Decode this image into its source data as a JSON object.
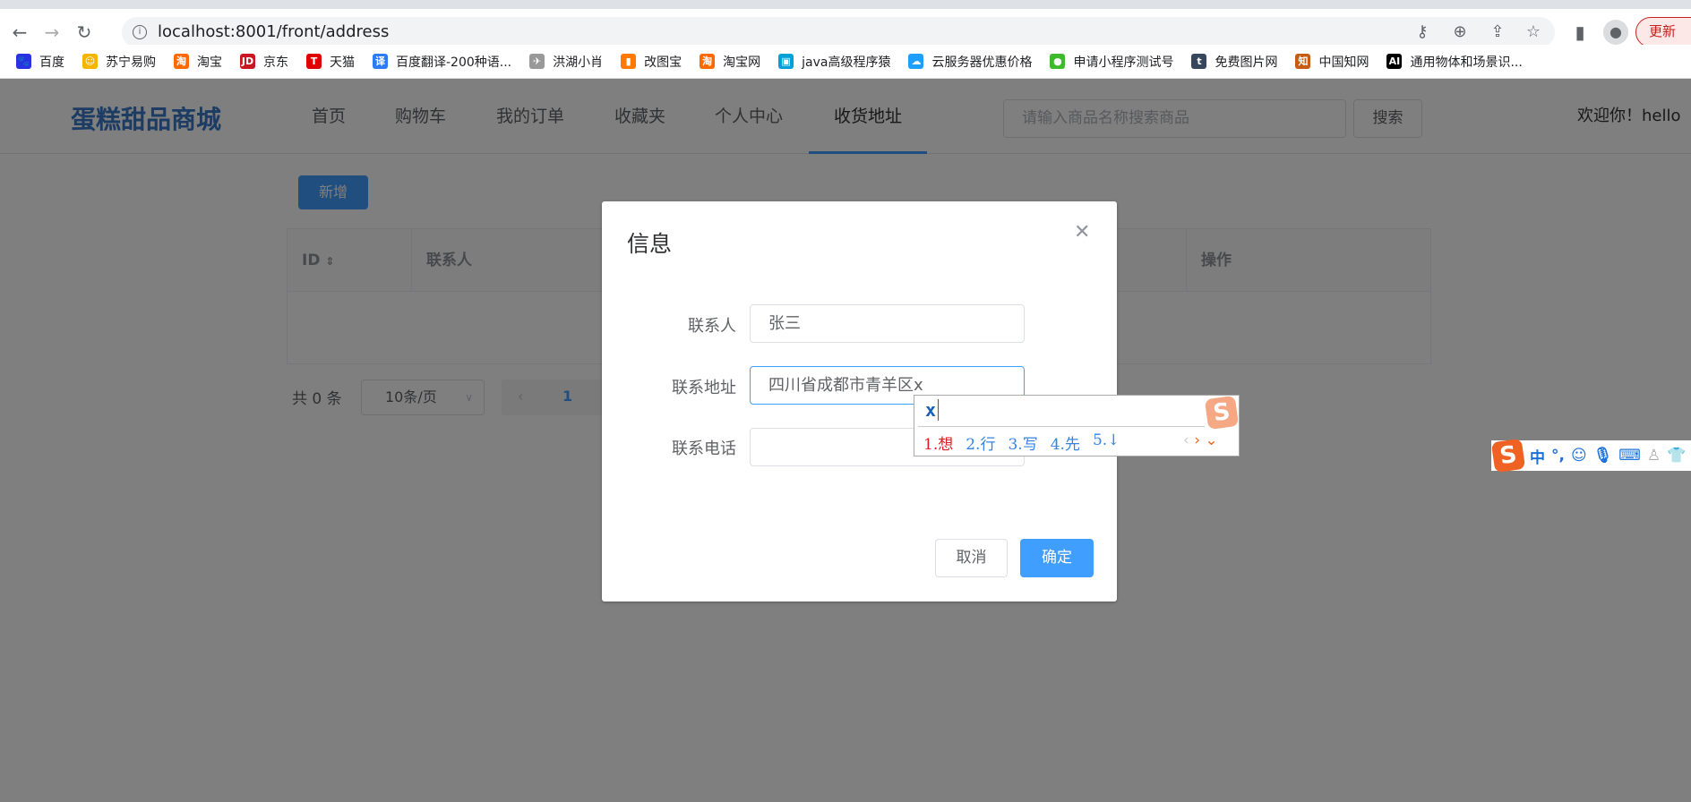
{
  "browser": {
    "url": "localhost:8001/front/address",
    "update_label": "更新",
    "bookmarks": [
      {
        "label": "百度",
        "icon": "baidu-icon",
        "color": "#2932e1",
        "glyph": "🐾"
      },
      {
        "label": "苏宁易购",
        "icon": "suning-icon",
        "color": "#f5b400",
        "glyph": "☺"
      },
      {
        "label": "淘宝",
        "icon": "taobao-icon",
        "color": "#ff6a00",
        "glyph": "淘"
      },
      {
        "label": "京东",
        "icon": "jd-icon",
        "color": "#c81623",
        "glyph": "JD"
      },
      {
        "label": "天猫",
        "icon": "tmall-icon",
        "color": "#e00000",
        "glyph": "T"
      },
      {
        "label": "百度翻译-200种语...",
        "icon": "translate-icon",
        "color": "#2b7cf6",
        "glyph": "译"
      },
      {
        "label": "洪湖小肖",
        "icon": "bird-icon",
        "color": "#999999",
        "glyph": "✈"
      },
      {
        "label": "改图宝",
        "icon": "gaitubao-icon",
        "color": "#ff7a00",
        "glyph": "▮"
      },
      {
        "label": "淘宝网",
        "icon": "taobao-icon",
        "color": "#ff6a00",
        "glyph": "淘"
      },
      {
        "label": "java高级程序猿",
        "icon": "bilibili-icon",
        "color": "#00a1d6",
        "glyph": "▣"
      },
      {
        "label": "云服务器优惠价格",
        "icon": "cloud-icon",
        "color": "#1e9fff",
        "glyph": "☁"
      },
      {
        "label": "申请小程序测试号",
        "icon": "wechat-icon",
        "color": "#3ebb2d",
        "glyph": "●"
      },
      {
        "label": "免费图片网",
        "icon": "tumblr-icon",
        "color": "#36465d",
        "glyph": "t"
      },
      {
        "label": "中国知网",
        "icon": "cnki-icon",
        "color": "#c75b12",
        "glyph": "知"
      },
      {
        "label": "通用物体和场景识...",
        "icon": "ai-icon",
        "color": "#000000",
        "glyph": "AI"
      }
    ]
  },
  "header": {
    "logo": "蛋糕甜品商城",
    "nav": [
      "首页",
      "购物车",
      "我的订单",
      "收藏夹",
      "个人中心",
      "收货地址"
    ],
    "active_nav": "收货地址",
    "search_placeholder": "请输入商品名称搜索商品",
    "search_button": "搜索",
    "welcome": "欢迎你！hello"
  },
  "main": {
    "add_button": "新增",
    "columns": [
      "ID",
      "联系人",
      "操作"
    ],
    "total": "共 0 条",
    "page_size": "10条/页",
    "current_page": "1"
  },
  "dialog": {
    "title": "信息",
    "fields": [
      {
        "label": "联系人",
        "value": "张三"
      },
      {
        "label": "联系地址",
        "value": "四川省成都市青羊区x"
      },
      {
        "label": "联系电话",
        "value": ""
      }
    ],
    "cancel": "取消",
    "confirm": "确定"
  },
  "ime": {
    "composition": "x",
    "candidates": [
      "1.想",
      "2.行",
      "3.写",
      "4.先",
      "5.↓"
    ],
    "toolbar": [
      "中",
      "°,"
    ]
  },
  "colors": {
    "primary": "#409eff",
    "overlay": "rgba(0,0,0,0.5)"
  }
}
